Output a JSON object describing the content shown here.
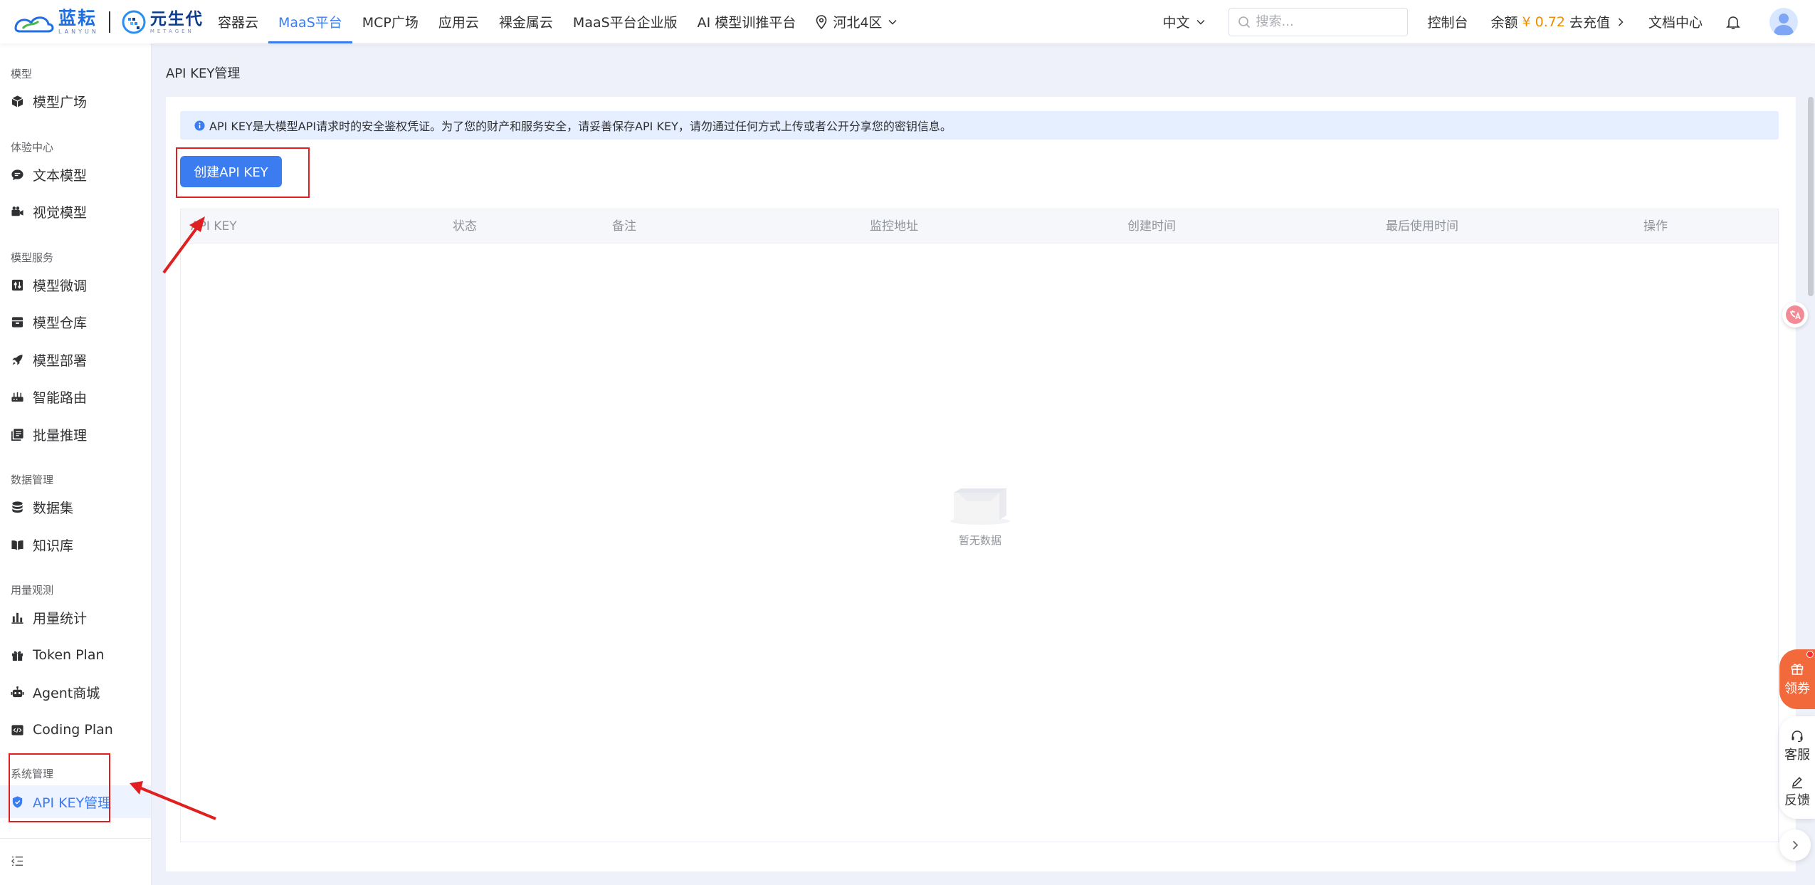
{
  "brand": {
    "logo1_cn": "蓝耘",
    "logo1_en": "LANYUN",
    "logo2_cn": "元生代",
    "logo2_en": "METAGEN"
  },
  "nav": {
    "items": [
      "容器云",
      "MaaS平台",
      "MCP广场",
      "应用云",
      "裸金属云",
      "MaaS平台企业版",
      "AI 模型训推平台"
    ],
    "active": "MaaS平台",
    "region": "河北4区"
  },
  "topright": {
    "lang": "中文",
    "search_placeholder": "搜索...",
    "console": "控制台",
    "balance_label": "余额",
    "balance_amount": "¥ 0.72",
    "recharge": "去充值",
    "docs": "文档中心"
  },
  "sidebar": {
    "sections": {
      "model": "模型",
      "experience": "体验中心",
      "service": "模型服务",
      "data": "数据管理",
      "usage": "用量观测",
      "system": "系统管理"
    },
    "items": {
      "model_square": "模型广场",
      "text_model": "文本模型",
      "vision_model": "视觉模型",
      "finetune": "模型微调",
      "repo": "模型仓库",
      "deploy": "模型部署",
      "router": "智能路由",
      "batch": "批量推理",
      "dataset": "数据集",
      "knowledge": "知识库",
      "usage_stats": "用量统计",
      "token_plan": "Token Plan",
      "agent_store": "Agent商城",
      "coding_plan": "Coding Plan",
      "api_key_mgmt": "API KEY管理"
    }
  },
  "main": {
    "page_title": "API KEY管理",
    "alert": "API KEY是大模型API请求时的安全鉴权凭证。为了您的财产和服务安全，请妥善保存API KEY，请勿通过任何方式上传或者公开分享您的密钥信息。",
    "create_button": "创建API KEY",
    "table": {
      "columns": [
        "API KEY",
        "状态",
        "备注",
        "监控地址",
        "创建时间",
        "最后使用时间",
        "操作"
      ],
      "rows": [],
      "empty_text": "暂无数据"
    }
  },
  "float": {
    "coupon": "领券",
    "service": "客服",
    "feedback": "反馈"
  },
  "colors": {
    "primary": "#3b7cf1",
    "balance": "#f08c00",
    "annotation": "#e02020",
    "coupon_bg": "#f26a3c"
  }
}
